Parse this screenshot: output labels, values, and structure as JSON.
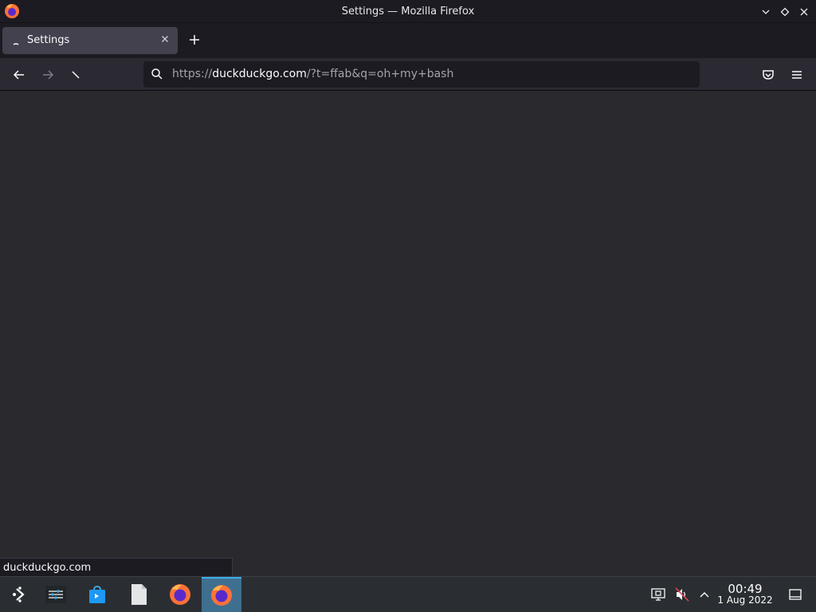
{
  "window": {
    "title": "Settings — Mozilla Firefox"
  },
  "tabs": [
    {
      "label": "Settings",
      "active": true
    }
  ],
  "toolbar": {
    "url_scheme": "https://",
    "url_domain": "duckduckgo.com",
    "url_rest": "/?t=ffab&q=oh+my+bash"
  },
  "statusbar": {
    "text": "duckduckgo.com"
  },
  "taskbar": {
    "clock_time": "00:49",
    "clock_date": "1 Aug 2022"
  },
  "colors": {
    "accent": "#3daee9",
    "chrome_dark": "#1c1b22",
    "content_bg": "#2a2a2e"
  },
  "icons": {
    "titlebar": [
      "firefox-icon",
      "chevron-down-icon",
      "diamond-icon",
      "close-icon"
    ],
    "navbar": [
      "back-arrow-icon",
      "forward-arrow-icon",
      "stop-icon",
      "search-icon",
      "pocket-icon",
      "hamburger-menu-icon"
    ],
    "taskbar": [
      "app-launcher-icon",
      "system-settings-icon",
      "discover-store-icon",
      "file-icon",
      "firefox-icon",
      "firefox-icon"
    ],
    "tray": [
      "screen-icon",
      "volume-muted-icon",
      "chevron-up-icon",
      "show-desktop-icon"
    ]
  }
}
